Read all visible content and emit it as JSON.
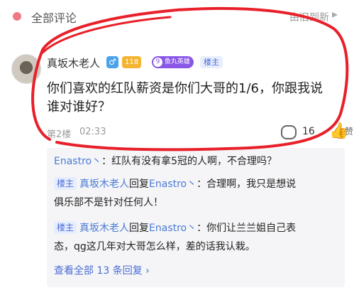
{
  "header": {
    "title": "全部评论",
    "sort_label": "由旧到新",
    "sort_caret": "▸"
  },
  "comment": {
    "username": "真坂木老人",
    "gender_badge": "♂",
    "level_badge": "118",
    "fan_badge_level": "9",
    "fan_badge_name": "鱼丸英雄",
    "op_badge": "楼主",
    "text_line1": "你们喜欢的红队薪资是你们大哥的1/6，你跟我说",
    "text_line2": "谁对谁好？",
    "floor": "第2楼",
    "time": "02:33",
    "reply_count": "16",
    "like_label": "赞"
  },
  "replies": [
    {
      "tag": "",
      "author": "Enastro丶",
      "text": "：红队有没有拿5冠的人啊，不合理吗？"
    },
    {
      "tag": "楼主",
      "author": "真坂木老人",
      "reply_word": "回复",
      "target": "Enastro丶",
      "text1": "：合理啊，我只是想说",
      "text2": "俱乐部不是针对任何人！"
    },
    {
      "tag": "楼主",
      "author": "真坂木老人",
      "reply_word": "回复",
      "target": "Enastro丶",
      "text1": "：你们让兰兰姐自己表",
      "text2": "态，qg这几年对大哥怎么样，差的话我认栽。"
    }
  ],
  "more_replies": "查看全部 13 条回复 ›",
  "colors": {
    "accent": "#4a6cd6",
    "annotation_red": "#e8202a"
  }
}
